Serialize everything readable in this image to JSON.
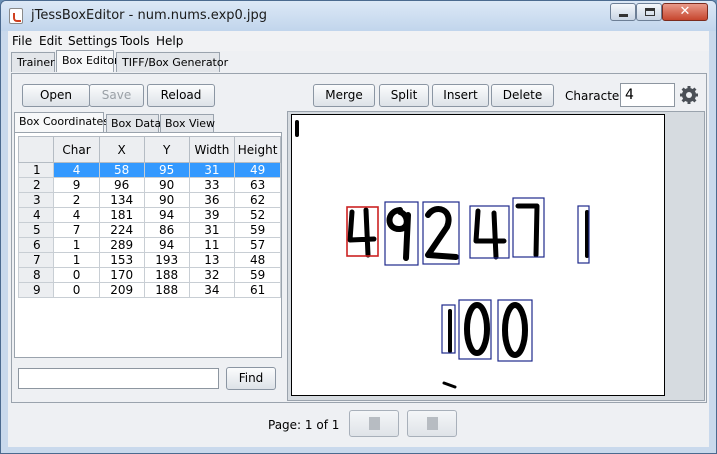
{
  "window": {
    "title": "jTessBoxEditor - num.nums.exp0.jpg",
    "close_glyph": "✕"
  },
  "menu": [
    "File",
    "Edit",
    "Settings",
    "Tools",
    "Help"
  ],
  "main_tabs": [
    "Trainer",
    "Box Editor",
    "TIFF/Box Generator"
  ],
  "toolbar": {
    "open": "Open",
    "save": "Save",
    "reload": "Reload",
    "merge": "Merge",
    "split": "Split",
    "insert": "Insert",
    "delete": "Delete",
    "character_label": "Character",
    "character_value": "4"
  },
  "sub_tabs": [
    "Box Coordinates",
    "Box Data",
    "Box View"
  ],
  "table": {
    "columns": [
      "Char",
      "X",
      "Y",
      "Width",
      "Height"
    ],
    "rows": [
      {
        "n": "1",
        "char": "4",
        "x": "58",
        "y": "95",
        "w": "31",
        "h": "49"
      },
      {
        "n": "2",
        "char": "9",
        "x": "96",
        "y": "90",
        "w": "33",
        "h": "63"
      },
      {
        "n": "3",
        "char": "2",
        "x": "134",
        "y": "90",
        "w": "36",
        "h": "62"
      },
      {
        "n": "4",
        "char": "4",
        "x": "181",
        "y": "94",
        "w": "39",
        "h": "52"
      },
      {
        "n": "5",
        "char": "7",
        "x": "224",
        "y": "86",
        "w": "31",
        "h": "59"
      },
      {
        "n": "6",
        "char": "1",
        "x": "289",
        "y": "94",
        "w": "11",
        "h": "57"
      },
      {
        "n": "7",
        "char": "1",
        "x": "153",
        "y": "193",
        "w": "13",
        "h": "48"
      },
      {
        "n": "8",
        "char": "0",
        "x": "170",
        "y": "188",
        "w": "32",
        "h": "59"
      },
      {
        "n": "9",
        "char": "0",
        "x": "209",
        "y": "188",
        "w": "34",
        "h": "61"
      }
    ],
    "selected_row": 0
  },
  "find": {
    "button": "Find",
    "value": ""
  },
  "footer": {
    "page_label": "Page: 1 of 1"
  },
  "colors": {
    "selection": "#3399ff",
    "selected_box": "#cc2222",
    "box": "#1e2a8c"
  },
  "icons": [
    "app-icon",
    "gear-icon",
    "prev-page-icon",
    "next-page-icon"
  ]
}
